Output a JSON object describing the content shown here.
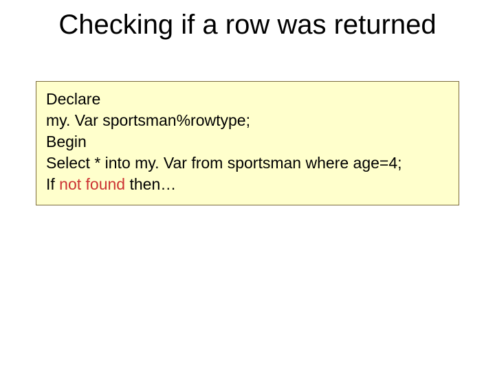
{
  "title": "Checking if a row was returned",
  "code": {
    "l1": "Declare",
    "l2": "my. Var sportsman%rowtype;",
    "l3": "Begin",
    "l4": "Select * into my. Var from sportsman where age=4;",
    "l5a": "If ",
    "l5nf": "not found",
    "l5b": " then…"
  }
}
